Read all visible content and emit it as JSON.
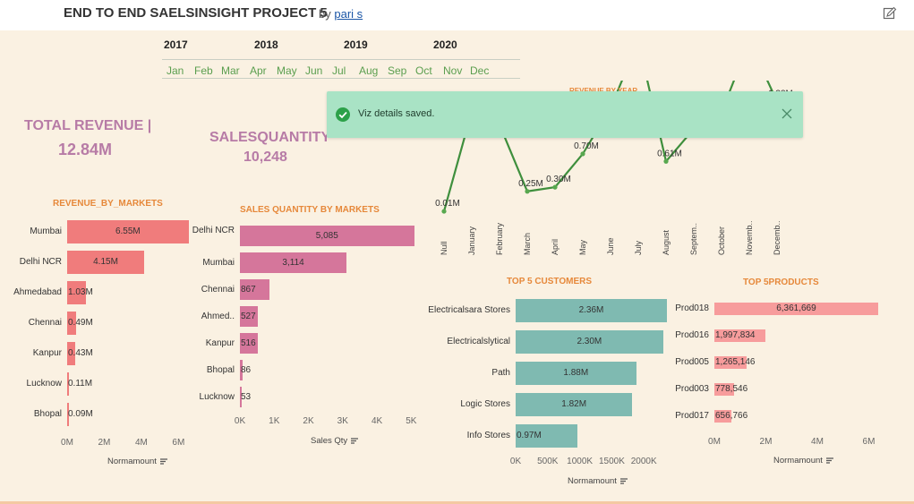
{
  "header": {
    "title": "END TO END SAELSINSIGHT PROJECT 5",
    "by": "by",
    "author": "pari s"
  },
  "filters": {
    "years": [
      "2017",
      "2018",
      "2019",
      "2020"
    ],
    "months": [
      "Jan",
      "Feb",
      "Mar",
      "Apr",
      "May",
      "Jun",
      "Jul",
      "Aug",
      "Sep",
      "Oct",
      "Nov",
      "Dec"
    ]
  },
  "kpis": {
    "revenue_label": "TOTAL REVENUE |",
    "revenue_value": "12.84M",
    "qty_label": "SALESQUANTITY",
    "qty_value": "10,248"
  },
  "toast": {
    "message": "Viz details saved."
  },
  "colors": {
    "background": "#faf1e2",
    "revenue_bars": "#f07c7c",
    "quantity_bars": "#d5769b",
    "customer_bars": "#7fbab1",
    "product_bars": "#f79c9c",
    "line": "#3f8f3d",
    "title_orange": "#e6883a",
    "kpi_purple": "#b77ba6"
  },
  "chart_data": [
    {
      "type": "bar",
      "orientation": "horizontal",
      "title": "REVENUE_BY_MARKETS",
      "categories": [
        "Mumbai",
        "Delhi NCR",
        "Ahmedabad",
        "Chennai",
        "Kanpur",
        "Lucknow",
        "Bhopal"
      ],
      "values": [
        6.55,
        4.15,
        1.03,
        0.49,
        0.43,
        0.11,
        0.09
      ],
      "labels": [
        "6.55M",
        "4.15M",
        "1.03M",
        "0.49M",
        "0.43M",
        "0.11M",
        "0.09M"
      ],
      "xticks": [
        "0M",
        "2M",
        "4M",
        "6M"
      ],
      "xtick_values": [
        0,
        2,
        4,
        6
      ],
      "xlim": [
        0,
        6.9
      ],
      "xlabel": "Normamount"
    },
    {
      "type": "bar",
      "orientation": "horizontal",
      "title": "SALES QUANTITY  BY MARKETS",
      "categories": [
        "Delhi NCR",
        "Mumbai",
        "Chennai",
        "Ahmed..",
        "Kanpur",
        "Bhopal",
        "Lucknow"
      ],
      "values": [
        5085,
        3114,
        867,
        527,
        516,
        86,
        53
      ],
      "labels": [
        "5,085",
        "3,114",
        "867",
        "527",
        "516",
        "86",
        "53"
      ],
      "xticks": [
        "0K",
        "1K",
        "2K",
        "3K",
        "4K",
        "5K"
      ],
      "xtick_values": [
        0,
        1000,
        2000,
        3000,
        4000,
        5000
      ],
      "xlim": [
        0,
        5200
      ],
      "xlabel": "Sales Qty"
    },
    {
      "type": "line",
      "title": "REVENUE BY YEAR",
      "categories": [
        "Null",
        "January",
        "February",
        "March",
        "April",
        "May",
        "June",
        "July",
        "August",
        "Septem..",
        "October",
        "Novemb..",
        "Decemb.."
      ],
      "values": [
        0.01,
        1.21,
        1.05,
        0.25,
        0.3,
        0.7,
        1.25,
        2.05,
        0.61,
        1.0,
        1.2,
        2.05,
        1.33
      ],
      "labels": [
        "0.01M",
        "1.21M",
        "1.05M",
        "0.25M",
        "0.30M",
        "0.70M",
        "1.25M",
        "",
        "0.61M",
        "1.00M",
        "1.20M",
        "",
        "1.33M"
      ]
    },
    {
      "type": "bar",
      "orientation": "horizontal",
      "title": "TOP 5 CUSTOMERS",
      "categories": [
        "Electricalsara Stores",
        "Electricalslytical",
        "Path",
        "Logic Stores",
        "Info Stores"
      ],
      "values": [
        2.36,
        2.3,
        1.88,
        1.82,
        0.97
      ],
      "labels": [
        "2.36M",
        "2.30M",
        "1.88M",
        "1.82M",
        "0.97M"
      ],
      "xticks": [
        "0K",
        "500K",
        "1000K",
        "1500K",
        "2000K"
      ],
      "xtick_values": [
        0,
        0.5,
        1.0,
        1.5,
        2.0
      ],
      "xlim": [
        0,
        2.43
      ],
      "xlabel": "Normamount"
    },
    {
      "type": "bar",
      "orientation": "horizontal",
      "title": "TOP 5PRODUCTS",
      "categories": [
        "Prod018",
        "Prod016",
        "Prod005",
        "Prod003",
        "Prod017"
      ],
      "values": [
        6361669,
        1997834,
        1265146,
        778546,
        656766
      ],
      "labels": [
        "6,361,669",
        "1,997,834",
        "1,265,146",
        "778,546",
        "656,766"
      ],
      "xticks": [
        "0M",
        "2M",
        "4M",
        "6M"
      ],
      "xtick_values": [
        0,
        2000000,
        4000000,
        6000000
      ],
      "xlim": [
        0,
        6400000
      ],
      "xlabel": "Normamount"
    }
  ]
}
